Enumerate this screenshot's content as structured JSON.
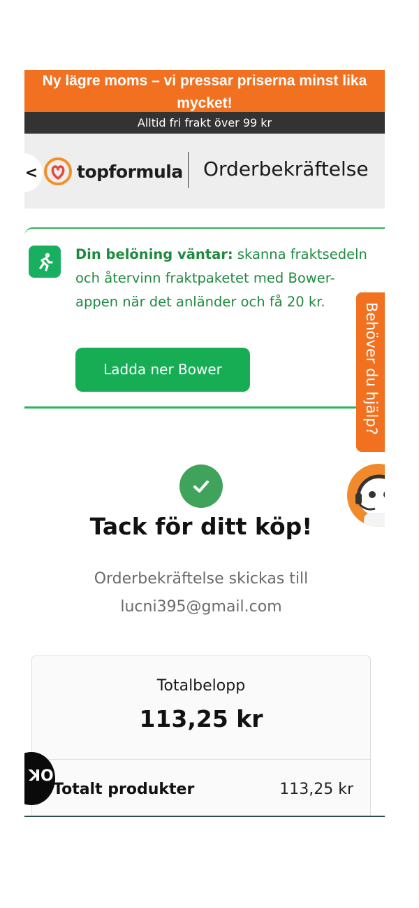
{
  "promo": {
    "line1": "Ny lägre moms – vi pressar priserna minst lika",
    "line2": "mycket!",
    "subline": "Alltid fri frakt över 99 kr"
  },
  "header": {
    "back_glyph": "<",
    "brand": "topformula",
    "title": "Orderbekräftelse"
  },
  "reward": {
    "lead": "Din belöning väntar:",
    "body": " skanna fraktsedeln och återvinn fraktpaketet med Bower-appen när det anländer och få 20 kr.",
    "button": "Ladda ner Bower"
  },
  "help": {
    "tab_label": "Behöver du hjälp?"
  },
  "confirmation": {
    "heading": "Tack för ditt köp!",
    "line1": "Orderbekräftelse skickas till",
    "email": "lucni395@gmail.com"
  },
  "summary": {
    "total_label": "Totalbelopp",
    "total_value": "113,25 kr",
    "rows": [
      {
        "label": "Totalt produkter",
        "value": "113,25 kr"
      }
    ]
  },
  "chat": {
    "glyph": "ꓘO"
  },
  "colors": {
    "accent_orange": "#f27120",
    "green": "#16ad55",
    "dark_bar": "#333333"
  }
}
